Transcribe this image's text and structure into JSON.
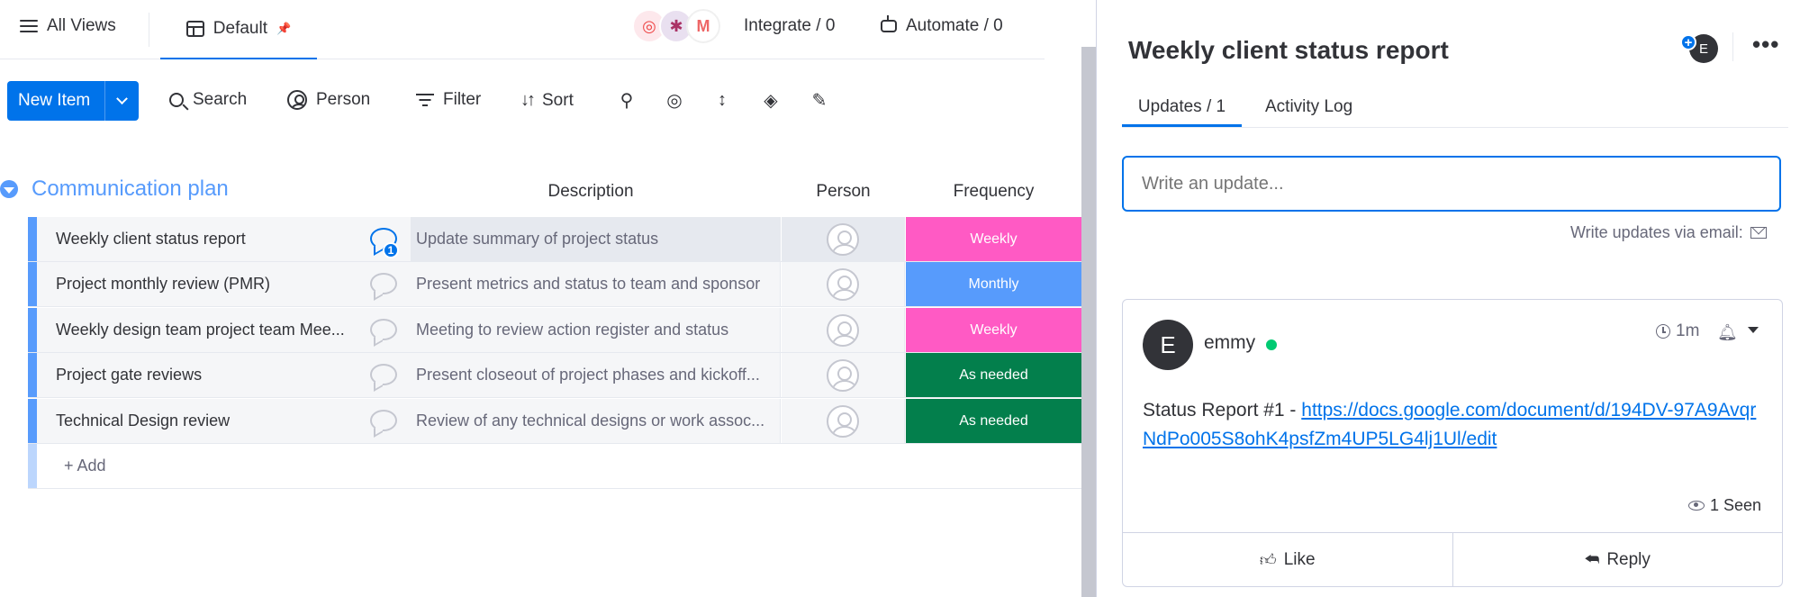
{
  "topbar": {
    "all_views": "All Views",
    "current_view": "Default",
    "integrate": "Integrate / 0",
    "automate": "Automate / 0"
  },
  "toolbar": {
    "new_item": "New Item",
    "search": "Search",
    "person": "Person",
    "filter": "Filter",
    "sort": "Sort"
  },
  "board": {
    "group_title": "Communication plan",
    "group_color": "#579bfc",
    "columns": [
      "Description",
      "Person",
      "Frequency"
    ],
    "rows": [
      {
        "name": "Weekly client status report",
        "description": "Update summary of project status",
        "frequency": "Weekly",
        "freq_color": "#ff5ac4",
        "updates": "1"
      },
      {
        "name": "Project monthly review (PMR)",
        "description": "Present metrics and status to team and sponsor",
        "frequency": "Monthly",
        "freq_color": "#579bfc"
      },
      {
        "name": "Weekly design team project team Mee...",
        "description": "Meeting to review action register and status",
        "frequency": "Weekly",
        "freq_color": "#ff5ac4"
      },
      {
        "name": "Project gate reviews",
        "description": "Present closeout of project phases and kickoff...",
        "frequency": "As needed",
        "freq_color": "#037f4c"
      },
      {
        "name": "Technical Design review",
        "description": "Review of any technical designs or work assoc...",
        "frequency": "As needed",
        "freq_color": "#037f4c"
      }
    ],
    "add_label": "+ Add"
  },
  "panel": {
    "title": "Weekly client status report",
    "subscriber_initial": "E",
    "tabs": [
      "Updates / 1",
      "Activity Log"
    ],
    "input_placeholder": "Write an update...",
    "via_email": "Write updates via email:",
    "update": {
      "author_initial": "E",
      "author": "emmy",
      "time": "1m",
      "text_prefix": "Status Report #1 - ",
      "link": "https://docs.google.com/document/d/194DV-97A9AvqrNdPo005S8ohK4psfZm4UP5LG4lj1Ul/edit",
      "seen": "1 Seen",
      "like": "Like",
      "reply": "Reply"
    }
  }
}
